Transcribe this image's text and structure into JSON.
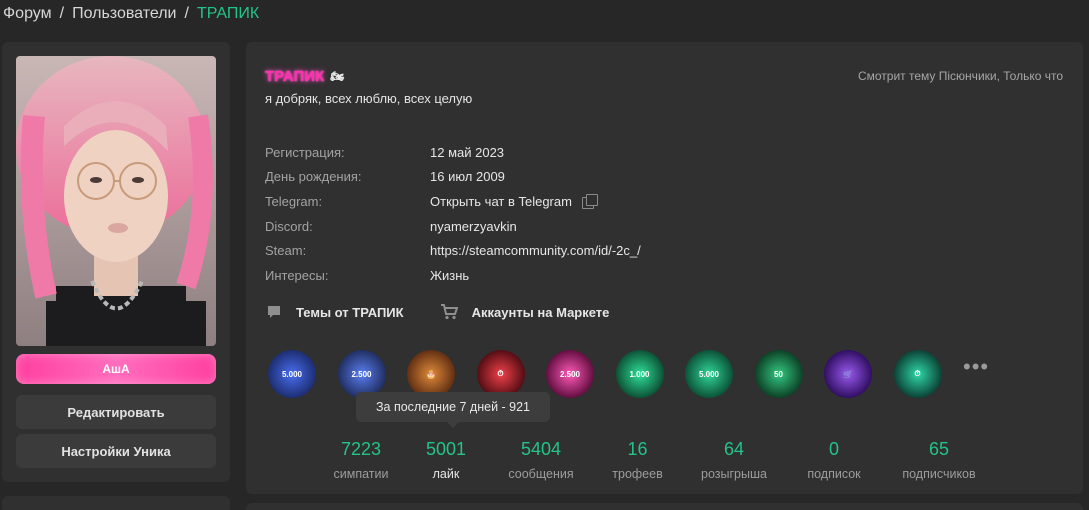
{
  "breadcrumb": {
    "items": [
      "Форум",
      "Пользователи"
    ],
    "current": "ТРАПИК",
    "separator": "/"
  },
  "sidebar": {
    "banner_text": "AшA",
    "edit_button": "Редактировать",
    "settings_button": "Настройки Уника"
  },
  "profile": {
    "username": "ТРАПИК",
    "username_badge": "🏍",
    "status": "я добряк, всех люблю, всех целую",
    "activity": "Смотрит тему Пiсюнчики, Только что",
    "fields": [
      {
        "label": "Регистрация:",
        "value": "12 май 2023"
      },
      {
        "label": "День рождения:",
        "value": "16 июл 2009"
      },
      {
        "label": "Telegram:",
        "value": "Открыть чат в Telegram",
        "icon": "copy-icon"
      },
      {
        "label": "Discord:",
        "value": "nyamerzyavkin"
      },
      {
        "label": "Steam:",
        "value": "https://steamcommunity.com/id/-2c_/"
      },
      {
        "label": "Интересы:",
        "value": "Жизнь"
      }
    ],
    "links": [
      {
        "label": "Темы от ТРАПИК",
        "icon": "comment-icon"
      },
      {
        "label": "Аккаунты на Маркете",
        "icon": "cart-icon"
      }
    ]
  },
  "trophies": [
    {
      "name": "trophy-5000-messages",
      "text": "5.000",
      "color": "#2b4bd6"
    },
    {
      "name": "trophy-2500-messages",
      "text": "2.500",
      "color": "#3a5fd8"
    },
    {
      "name": "trophy-cake",
      "text": "",
      "color": "#a8552a"
    },
    {
      "name": "trophy-active-red",
      "text": "",
      "color": "#c8202a"
    },
    {
      "name": "trophy-2500-likes",
      "text": "2.500",
      "color": "#d8349a"
    },
    {
      "name": "trophy-1000-likes",
      "text": "1.000",
      "color": "#1fb37a"
    },
    {
      "name": "trophy-5000-likes",
      "text": "5.000",
      "color": "#1faf77"
    },
    {
      "name": "trophy-50-giveaways",
      "text": "50",
      "color": "#22a36b"
    },
    {
      "name": "trophy-market",
      "text": "",
      "color": "#7b3bd8"
    },
    {
      "name": "trophy-active-green",
      "text": "",
      "color": "#1ea87a"
    }
  ],
  "more_label": "•••",
  "tooltip": "За последние 7 дней - 921",
  "stats": [
    {
      "value": "7223",
      "label": "симпатии"
    },
    {
      "value": "5001",
      "label": "лайк",
      "active": true
    },
    {
      "value": "5404",
      "label": "сообщения"
    },
    {
      "value": "16",
      "label": "трофеев"
    },
    {
      "value": "64",
      "label": "розыгрыша"
    },
    {
      "value": "0",
      "label": "подписок"
    },
    {
      "value": "65",
      "label": "подписчиков"
    }
  ],
  "colors": {
    "accent": "#22c48a",
    "username": "#ff2fb0",
    "panel": "#303030",
    "background": "#272727"
  }
}
